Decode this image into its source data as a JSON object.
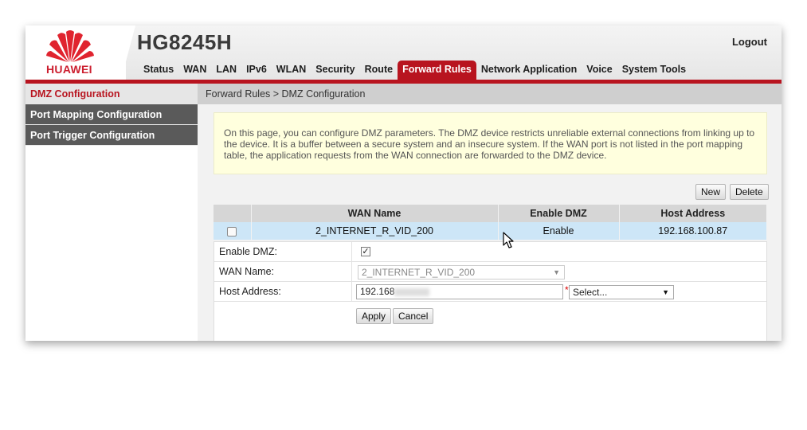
{
  "header": {
    "brand": "HUAWEI",
    "model": "HG8245H",
    "logout_label": "Logout",
    "nav": [
      "Status",
      "WAN",
      "LAN",
      "IPv6",
      "WLAN",
      "Security",
      "Route",
      "Forward Rules",
      "Network Application",
      "Voice",
      "System Tools"
    ],
    "active_nav": "Forward Rules",
    "accent_color": "#b8141f"
  },
  "sidebar": {
    "items": [
      {
        "label": "DMZ Configuration",
        "active": true
      },
      {
        "label": "Port Mapping Configuration",
        "active": false
      },
      {
        "label": "Port Trigger Configuration",
        "active": false
      }
    ]
  },
  "main": {
    "breadcrumb": "Forward Rules > DMZ Configuration",
    "info_text": "On this page, you can configure DMZ parameters. The DMZ device restricts unreliable external connections from linking up to the device. It is a buffer between a secure system and an insecure system. If the WAN port is not listed in the port mapping table, the application requests from the WAN connection are forwarded to the DMZ device.",
    "new_label": "New",
    "delete_label": "Delete",
    "table": {
      "columns": [
        "WAN Name",
        "Enable DMZ",
        "Host Address"
      ],
      "rows": [
        {
          "wan_name": "2_INTERNET_R_VID_200",
          "enable_dmz": "Enable",
          "host_address": "192.168.100.87"
        }
      ]
    },
    "form": {
      "enable_dmz_label": "Enable DMZ:",
      "enable_dmz_checked": true,
      "wan_name_label": "WAN Name:",
      "wan_name_value": "2_INTERNET_R_VID_200",
      "host_address_label": "Host Address:",
      "host_address_value": "192.168",
      "host_select_value": "Select...",
      "apply_label": "Apply",
      "cancel_label": "Cancel"
    }
  }
}
